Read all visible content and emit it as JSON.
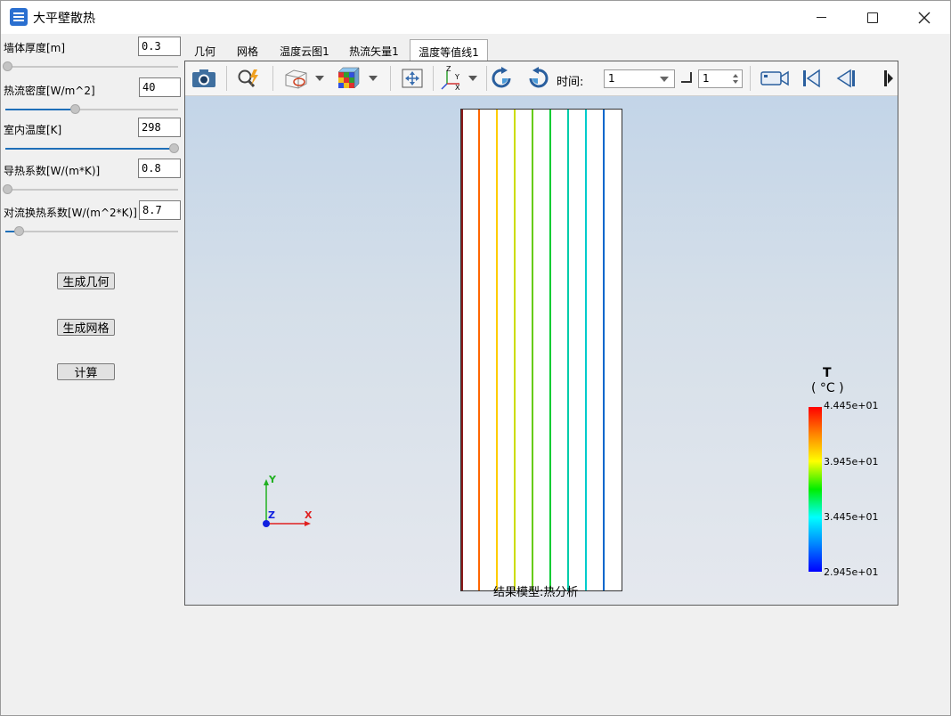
{
  "window": {
    "title": "大平壁散热"
  },
  "params": [
    {
      "label": "墙体厚度[m]",
      "value": "0.3",
      "slider_fraction": 0.0
    },
    {
      "label": "热流密度[W/m^2]",
      "value": "40",
      "slider_fraction": 0.4
    },
    {
      "label": "室内温度[K]",
      "value": "298",
      "slider_fraction": 1.0
    },
    {
      "label": "导热系数[W/(m*K)]",
      "value": "0.8",
      "slider_fraction": 0.0
    },
    {
      "label": "对流换热系数[W/(m^2*K)]",
      "value": "8.7",
      "slider_fraction": 0.08
    }
  ],
  "buttons": {
    "gen_geometry": "生成几何",
    "gen_mesh": "生成网格",
    "compute": "计算"
  },
  "tabs": [
    {
      "label": "几何",
      "active": false
    },
    {
      "label": "网格",
      "active": false
    },
    {
      "label": "温度云图1",
      "active": false
    },
    {
      "label": "热流矢量1",
      "active": false
    },
    {
      "label": "温度等值线1",
      "active": true
    }
  ],
  "toolbar": {
    "icons": [
      "camera-icon",
      "zoom-icon",
      "display-mode-icon",
      "colormap-cube-icon",
      "fit-view-icon",
      "axes-orientation-icon",
      "rotate-ccw-icon",
      "rotate-cw-icon"
    ],
    "time_label": "时间:",
    "time_value": "1",
    "step_value": "1",
    "playback_icons": [
      "record-camera-icon",
      "first-frame-icon",
      "prev-frame-icon",
      "next-frame-icon"
    ]
  },
  "viewport": {
    "model_caption": "结果模型:热分析",
    "axis_labels": {
      "x": "X",
      "y": "Y",
      "z": "Z"
    },
    "contour_colors": [
      "#8b1a1a",
      "#ff6600",
      "#ffcc00",
      "#ccdd00",
      "#66cc00",
      "#00cc33",
      "#00ccaa",
      "#00cccc",
      "#0066cc"
    ]
  },
  "legend": {
    "title": "T",
    "unit": "( °C )",
    "labels": [
      "4.445e+01",
      "3.945e+01",
      "3.445e+01",
      "2.945e+01"
    ]
  }
}
